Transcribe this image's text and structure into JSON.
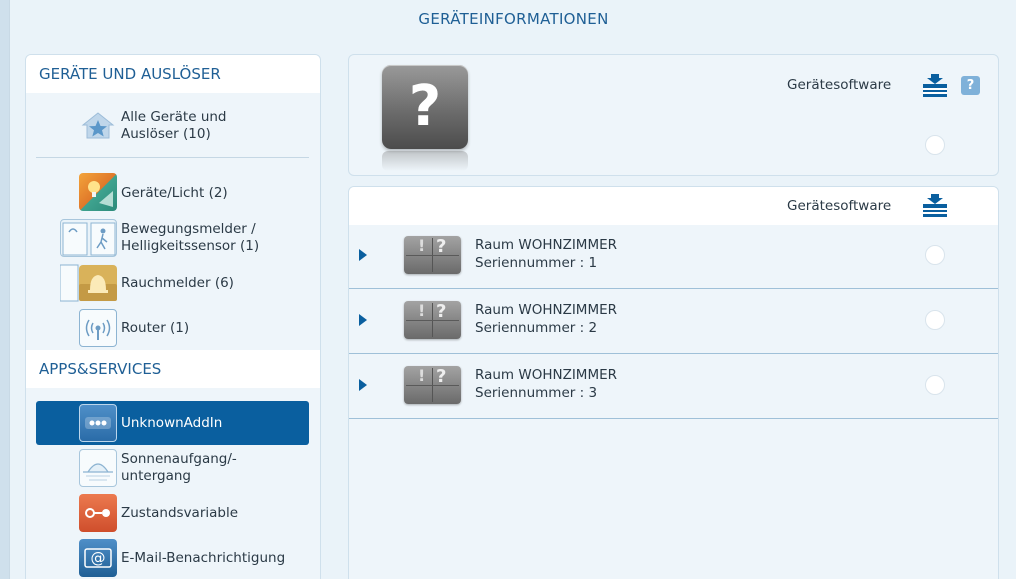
{
  "page_title": "GERÄTEINFORMATIONEN",
  "sidebar": {
    "devices_heading": "GERÄTE UND AUSLÖSER",
    "device_items": [
      {
        "label_line1": "Alle Geräte und",
        "label_line2": "Auslöser (10)",
        "icon": "star-house-icon"
      },
      {
        "label_line1": "Geräte/Licht (2)",
        "label_line2": "",
        "icon": "lightbulb-icon"
      },
      {
        "label_line1": "Bewegungsmelder /",
        "label_line2": "Helligkeitssensor (1)",
        "icon": "motion-sensor-icon"
      },
      {
        "label_line1": "Rauchmelder (6)",
        "label_line2": "",
        "icon": "bell-icon"
      },
      {
        "label_line1": "Router (1)",
        "label_line2": "",
        "icon": "router-icon"
      }
    ],
    "apps_heading": "APPS&SERVICES",
    "app_items": [
      {
        "label_line1": "UnknownAddIn",
        "label_line2": "",
        "icon": "dots-icon",
        "active": true
      },
      {
        "label_line1": "Sonnenaufgang/-",
        "label_line2": "untergang",
        "icon": "sunrise-icon"
      },
      {
        "label_line1": "Zustandsvariable",
        "label_line2": "",
        "icon": "state-variable-icon"
      },
      {
        "label_line1": "E-Mail-Benachrichtigung",
        "label_line2": "",
        "icon": "email-at-icon"
      }
    ]
  },
  "device_panel": {
    "software_label": "Gerätesoftware",
    "help_label": "?",
    "device_icon_glyph": "?"
  },
  "list_panel": {
    "software_label": "Gerätesoftware",
    "rows": [
      {
        "room": "Raum WOHNZIMMER",
        "serial": "Seriennummer : 1"
      },
      {
        "room": "Raum WOHNZIMMER",
        "serial": "Seriennummer : 2"
      },
      {
        "room": "Raum WOHNZIMMER",
        "serial": "Seriennummer : 3"
      }
    ]
  },
  "colors": {
    "accent": "#0a5f9f",
    "heading": "#1f5f95",
    "background": "#eaf3f9"
  }
}
